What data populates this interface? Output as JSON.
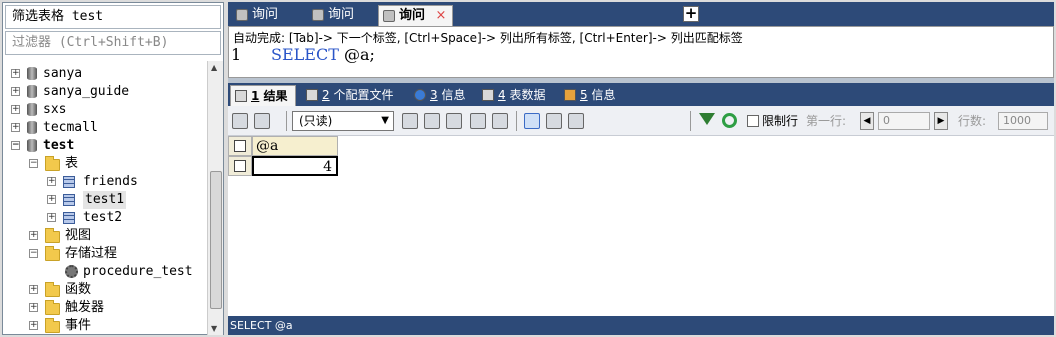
{
  "sidebar": {
    "title": "筛选表格 test",
    "filter_placeholder": "过滤器 (Ctrl+Shift+B)",
    "tree": {
      "sanya": "sanya",
      "sanya_guide": "sanya_guide",
      "sxs": "sxs",
      "tecmall": "tecmall",
      "test": "test",
      "tables": "表",
      "friends": "friends",
      "test1": "test1",
      "test2": "test2",
      "views": "视图",
      "procedures": "存储过程",
      "procedure_test": "procedure_test",
      "functions": "函数",
      "triggers": "触发器",
      "events": "事件"
    }
  },
  "editor": {
    "tabs": [
      "询问",
      "询问",
      "询问"
    ],
    "active_tab_close": "×",
    "hint": "自动完成: [Tab]-> 下一个标签, [Ctrl+Space]-> 列出所有标签, [Ctrl+Enter]-> 列出匹配标签",
    "line_number": "1",
    "code_keyword": "SELECT",
    "code_rest": " @a;"
  },
  "results": {
    "tabs": [
      {
        "num": "1",
        "label": "结果"
      },
      {
        "num": "2",
        "label": "个配置文件"
      },
      {
        "num": "3",
        "label": "信息"
      },
      {
        "num": "4",
        "label": "表数据"
      },
      {
        "num": "5",
        "label": "信息"
      }
    ],
    "readonly_option": "(只读)",
    "limit_rows_label": "限制行",
    "first_row_label": "第一行:",
    "first_row_value": "0",
    "row_count_label": "行数:",
    "row_count_value": "1000",
    "column_header": "@a",
    "cell_value": "4"
  },
  "status_bar": "SELECT @a"
}
